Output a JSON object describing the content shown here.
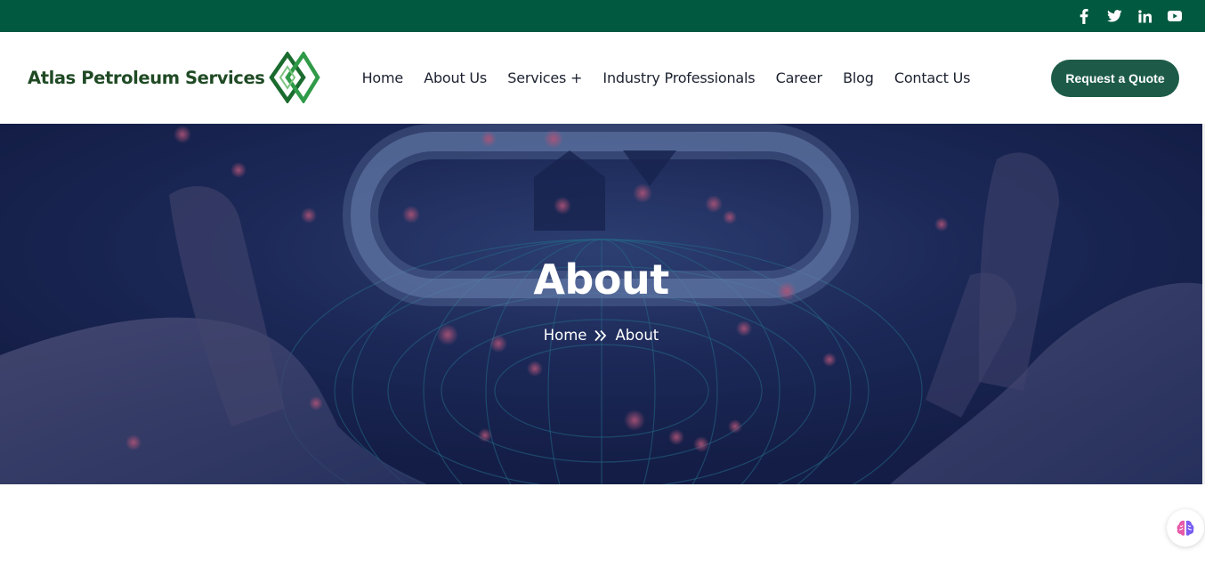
{
  "topbar": {
    "social": [
      {
        "icon": "facebook-icon"
      },
      {
        "icon": "twitter-icon"
      },
      {
        "icon": "linkedin-icon"
      },
      {
        "icon": "youtube-icon"
      }
    ],
    "background": "#015940"
  },
  "header": {
    "logo_text": "Atlas Petroleum Services",
    "nav": [
      {
        "label": "Home"
      },
      {
        "label": "About Us"
      },
      {
        "label": "Services +"
      },
      {
        "label": "Industry Professionals"
      },
      {
        "label": "Career"
      },
      {
        "label": "Blog"
      },
      {
        "label": "Contact Us"
      }
    ],
    "cta_label": "Request a Quote",
    "cta_color": "#1d5b48"
  },
  "hero": {
    "title": "About",
    "breadcrumb": {
      "home": "Home",
      "current": "About",
      "separator_icon": "double-chevron-right-icon"
    }
  },
  "assistant": {
    "icon": "brain-icon"
  }
}
